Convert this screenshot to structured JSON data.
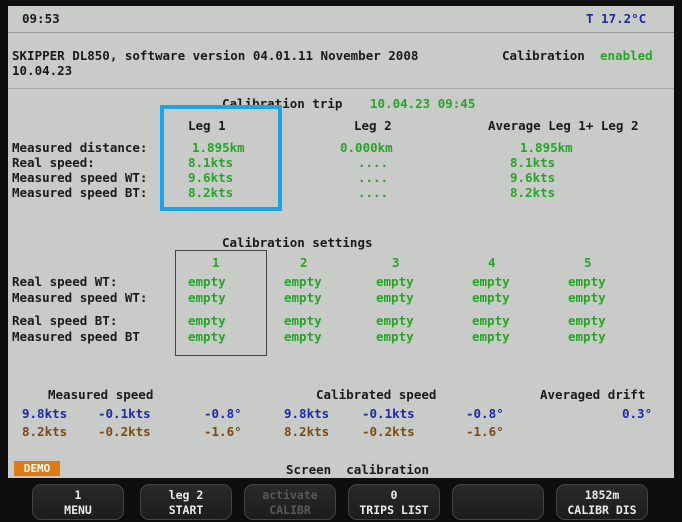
{
  "status": {
    "time": "09:53",
    "temperature": "T 17.2°C"
  },
  "header": {
    "device_line": "SKIPPER DL850, software version 04.01.11 November 2008",
    "calibration_label": "Calibration",
    "calibration_state": "enabled",
    "date": "10.04.23"
  },
  "trip": {
    "title": "Calibration trip",
    "title_time": "10.04.23 09:45",
    "col_headers": [
      "Leg 1",
      "Leg 2",
      "Average Leg 1+ Leg 2"
    ],
    "row_labels": [
      "Measured distance:",
      "Real speed:",
      "Measured speed WT:",
      "Measured speed BT:"
    ],
    "leg1": [
      "1.895km",
      "8.1kts",
      "9.6kts",
      "8.2kts"
    ],
    "leg2": [
      "0.000km",
      "....",
      "....",
      "...."
    ],
    "average": [
      "1.895km",
      "8.1kts",
      "9.6kts",
      "8.2kts"
    ]
  },
  "settings": {
    "title": "Calibration settings",
    "columns": [
      "1",
      "2",
      "3",
      "4",
      "5"
    ],
    "row_labels": [
      "Real speed WT:",
      "Measured speed WT:",
      "Real speed BT:",
      "Measured speed BT"
    ],
    "cell_value": "empty"
  },
  "summary": {
    "measured_label": "Measured speed",
    "calibrated_label": "Calibrated speed",
    "drift_label": "Averaged drift",
    "row1": [
      "9.8kts",
      "-0.1kts",
      "-0.8°",
      "9.8kts",
      "-0.1kts",
      "-0.8°",
      "0.3°"
    ],
    "row2": [
      "8.2kts",
      "-0.2kts",
      "-1.6°",
      "8.2kts",
      "-0.2kts",
      "-1.6°"
    ]
  },
  "footer": {
    "demo_badge": "DEMO",
    "screen_label": "Screen  calibration"
  },
  "softkeys": [
    {
      "line1": "1",
      "line2": "MENU",
      "enabled": true
    },
    {
      "line1": "leg 2",
      "line2": "START",
      "enabled": true
    },
    {
      "line1": "activate",
      "line2": "CALIBR",
      "enabled": false
    },
    {
      "line1": "0",
      "line2": "TRIPS LIST",
      "enabled": true
    },
    {
      "line1": "",
      "line2": "",
      "enabled": true
    },
    {
      "line1": "1852m",
      "line2": "CALIBR DIS",
      "enabled": true
    }
  ],
  "colors": {
    "enabled_green": "#28a428",
    "value_blue": "#1c2aa8",
    "value_brown": "#7a4a12",
    "highlight": "#1ea4e6",
    "demo_orange": "#e07a14"
  }
}
